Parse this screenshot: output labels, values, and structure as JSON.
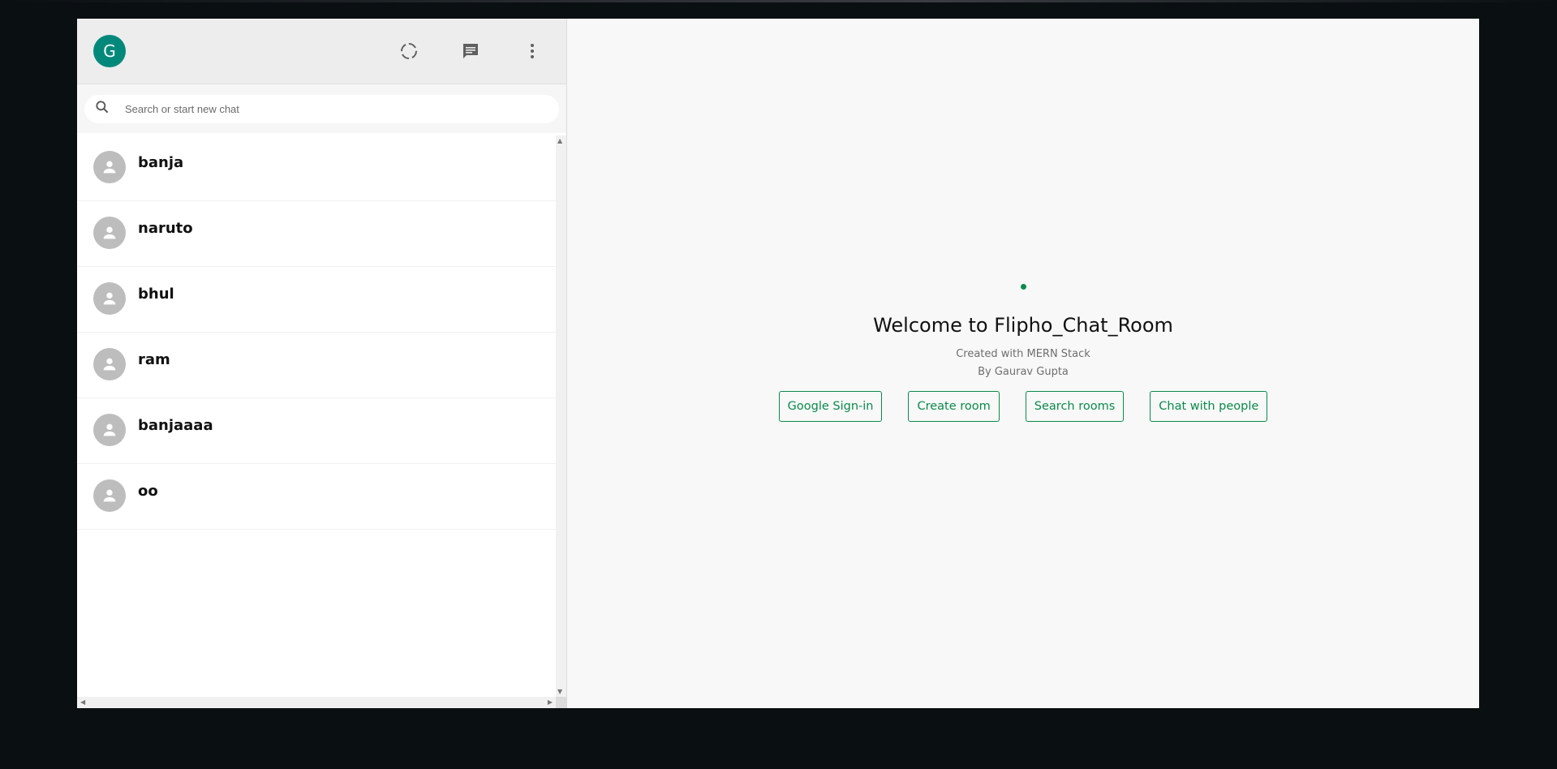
{
  "user": {
    "avatar_initial": "G"
  },
  "header": {
    "icons": [
      "status-icon",
      "new-chat-icon",
      "more-vert-icon"
    ]
  },
  "search": {
    "placeholder": "Search or start new chat"
  },
  "chats": [
    {
      "name": "banja"
    },
    {
      "name": "naruto"
    },
    {
      "name": "bhul"
    },
    {
      "name": "ram"
    },
    {
      "name": "banjaaaa"
    },
    {
      "name": "oo"
    }
  ],
  "welcome": {
    "title": "Welcome to Flipho_Chat_Room",
    "subtitle": "Created with MERN Stack",
    "author": "By Gaurav Gupta",
    "buttons": {
      "google": "Google Sign-in",
      "create": "Create room",
      "search": "Search rooms",
      "chat": "Chat with people"
    }
  },
  "colors": {
    "accent": "#0a8a4a",
    "avatar": "#00897b",
    "background": "#0a0f12"
  }
}
